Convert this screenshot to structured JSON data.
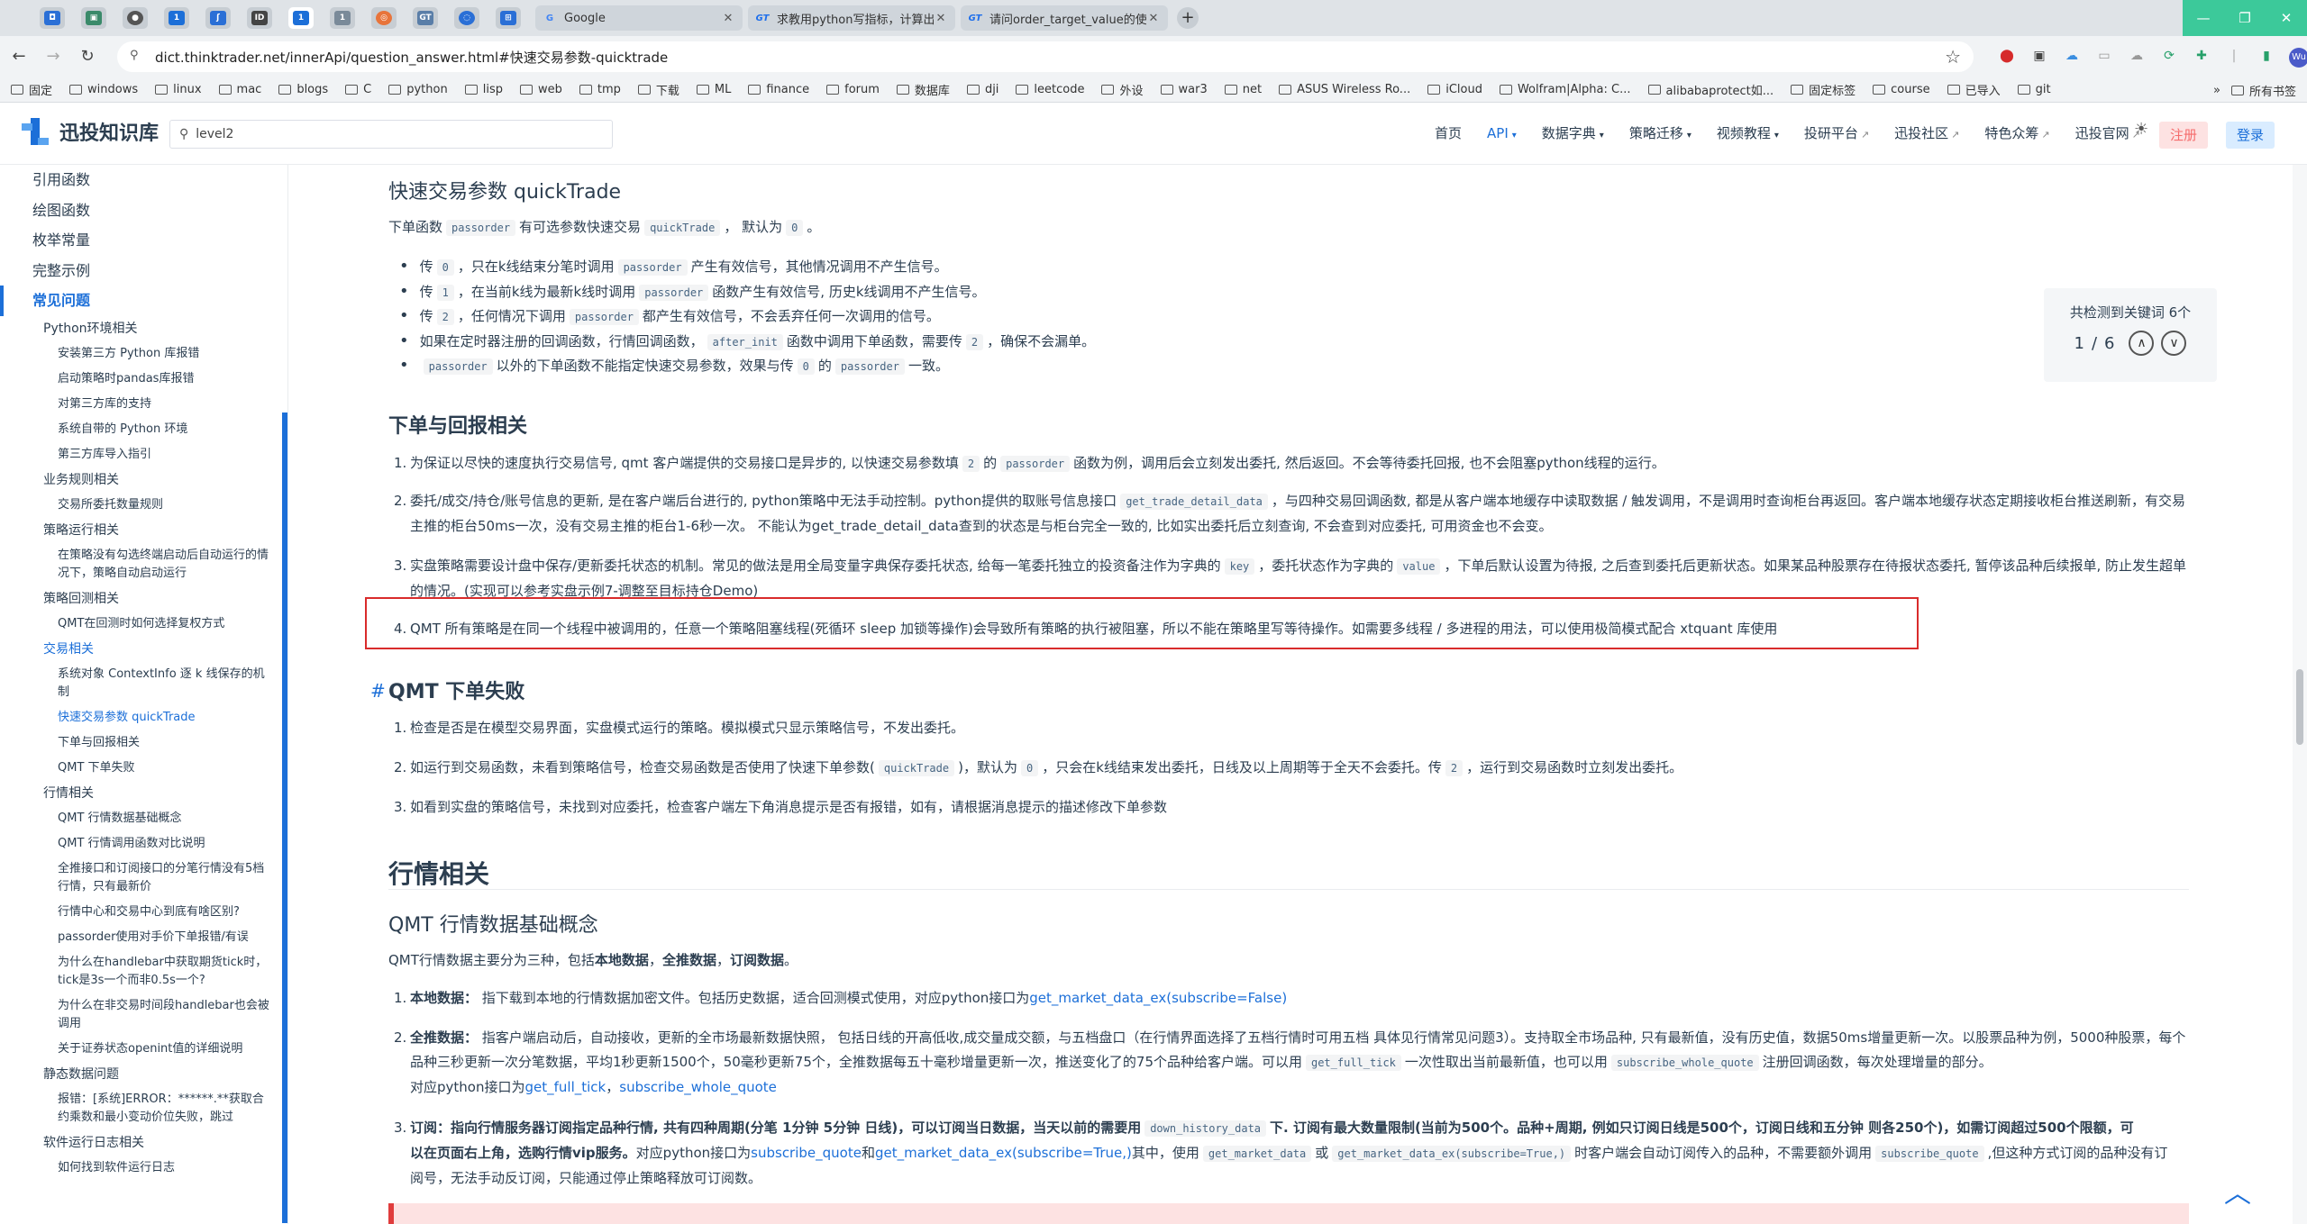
{
  "browser": {
    "tabs": [
      {
        "label": "Google",
        "icon": "google-icon"
      },
      {
        "label": "求教用python写指标，计算出",
        "icon": "gt-icon"
      },
      {
        "label": "请问order_target_value的使用",
        "icon": "gt-icon"
      }
    ],
    "url": "dict.thinktrader.net/innerApi/question_answer.html#快速交易参数-quicktrade",
    "bookmarks": [
      "固定",
      "windows",
      "linux",
      "mac",
      "blogs",
      "C",
      "python",
      "lisp",
      "web",
      "tmp",
      "下载",
      "ML",
      "finance",
      "forum",
      "数据库",
      "dji",
      "leetcode",
      "外设",
      "war3",
      "net",
      "ASUS Wireless Ro...",
      "iCloud",
      "Wolfram|Alpha: C...",
      "alibabaprotect如...",
      "固定标签",
      "course",
      "已导入",
      "git"
    ],
    "bookmarks_more": "»",
    "all_bookmarks": "所有书签"
  },
  "site": {
    "title": "迅投知识库",
    "search_value": "level2",
    "nav": [
      {
        "label": "首页",
        "caret": false,
        "ext": false,
        "active": false
      },
      {
        "label": "API",
        "caret": true,
        "ext": false,
        "active": true
      },
      {
        "label": "数据字典",
        "caret": true,
        "ext": false,
        "active": false
      },
      {
        "label": "策略迁移",
        "caret": true,
        "ext": false,
        "active": false
      },
      {
        "label": "视频教程",
        "caret": true,
        "ext": false,
        "active": false
      },
      {
        "label": "投研平台",
        "caret": false,
        "ext": true,
        "active": false
      },
      {
        "label": "迅投社区",
        "caret": false,
        "ext": true,
        "active": false
      },
      {
        "label": "特色众筹",
        "caret": false,
        "ext": true,
        "active": false
      },
      {
        "label": "迅投官网",
        "caret": false,
        "ext": true,
        "active": false
      }
    ],
    "register": "注册",
    "login": "登录"
  },
  "sidebar": {
    "top": [
      "引用函数",
      "绘图函数",
      "枚举常量",
      "完整示例"
    ],
    "active_section": "常见问题",
    "items": [
      {
        "level": 2,
        "label": "Python环境相关"
      },
      {
        "level": 3,
        "label": "安装第三方 Python 库报错"
      },
      {
        "level": 3,
        "label": "启动策略时pandas库报错"
      },
      {
        "level": 3,
        "label": "对第三方库的支持"
      },
      {
        "level": 3,
        "label": "系统自带的 Python 环境"
      },
      {
        "level": 3,
        "label": "第三方库导入指引"
      },
      {
        "level": 2,
        "label": "业务规则相关"
      },
      {
        "level": 3,
        "label": "交易所委托数量规则"
      },
      {
        "level": 2,
        "label": "策略运行相关"
      },
      {
        "level": 3,
        "label": "在策略没有勾选终端启动后自动运行的情况下，策略自动启动运行"
      },
      {
        "level": 2,
        "label": "策略回测相关"
      },
      {
        "level": 3,
        "label": "QMT在回测时如何选择复权方式"
      },
      {
        "level": 2,
        "label": "交易相关",
        "active": true
      },
      {
        "level": 3,
        "label": "系统对象 ContextInfo 逐 k 线保存的机制"
      },
      {
        "level": 3,
        "label": "快速交易参数 quickTrade",
        "active": true
      },
      {
        "level": 3,
        "label": "下单与回报相关"
      },
      {
        "level": 3,
        "label": "QMT 下单失败"
      },
      {
        "level": 2,
        "label": "行情相关"
      },
      {
        "level": 3,
        "label": "QMT 行情数据基础概念"
      },
      {
        "level": 3,
        "label": "QMT 行情调用函数对比说明"
      },
      {
        "level": 3,
        "label": "全推接口和订阅接口的分笔行情没有5档行情，只有最新价"
      },
      {
        "level": 3,
        "label": "行情中心和交易中心到底有啥区别?"
      },
      {
        "level": 3,
        "label": "passorder使用对手价下单报错/有误"
      },
      {
        "level": 3,
        "label": "为什么在handlebar中获取期货tick时，tick是3s一个而非0.5s一个?"
      },
      {
        "level": 3,
        "label": "为什么在非交易时间段handlebar也会被调用"
      },
      {
        "level": 3,
        "label": "关于证券状态openint值的详细说明"
      },
      {
        "level": 2,
        "label": "静态数据问题"
      },
      {
        "level": 3,
        "label": "报错：[系统]ERROR：******.**获取合约乘数和最小变动价位失败，跳过"
      },
      {
        "level": 2,
        "label": "软件运行日志相关"
      },
      {
        "level": 3,
        "label": "如何找到软件运行日志"
      }
    ]
  },
  "content": {
    "quicktrade": {
      "title": "快速交易参数 quickTrade",
      "intro": [
        "下单函数",
        "passorder",
        "有可选参数快速交易",
        "quickTrade",
        "，  默认为",
        "0",
        "。"
      ],
      "bullets": [
        [
          "传",
          "0",
          "，只在k线结束分笔时调用",
          "passorder",
          "产生有效信号，其他情况调用不产生信号。"
        ],
        [
          "传",
          "1",
          "，在当前k线为最新k线时调用",
          "passorder",
          "函数产生有效信号, 历史k线调用不产生信号。"
        ],
        [
          "传",
          "2",
          "，任何情况下调用",
          "passorder",
          "都产生有效信号，不会丢弃任何一次调用的信号。"
        ],
        [
          "如果在定时器注册的回调函数，行情回调函数，",
          "after_init",
          "函数中调用下单函数，需要传",
          "2",
          "，确保不会漏单。"
        ],
        [
          "",
          "passorder",
          "以外的下单函数不能指定快速交易参数，效果与传",
          "0",
          "的",
          "passorder",
          "一致。"
        ]
      ]
    },
    "order_report": {
      "title": "下单与回报相关",
      "items": [
        [
          "1.",
          "为保证以尽快的速度执行交易信号, qmt 客户端提供的交易接口是异步的, 以快速交易参数填",
          "2",
          "的",
          "passorder",
          "函数为例，调用后会立刻发出委托, 然后返回。不会等待委托回报, 也不会阻塞python线程的运行。"
        ],
        [
          "2.",
          "委托/成交/持仓/账号信息的更新, 是在客户端后台进行的, python策略中无法手动控制。python提供的取账号信息接口",
          "get_trade_detail_data",
          "，与四种交易回调函数, 都是从客户端本地缓存中读取数据 / 触发调用，不是调用时查询柜台再返回。客户端本地缓存状态定期接收柜台推送刷新，有交易主推的柜台50ms一次，没有交易主推的柜台1-6秒一次。 不能认为get_trade_detail_data查到的状态是与柜台完全一致的, 比如实出委托后立刻查询, 不会查到对应委托, 可用资金也不会变。"
        ],
        [
          "3.",
          "实盘策略需要设计盘中保存/更新委托状态的机制。常见的做法是用全局变量字典保存委托状态, 给每一笔委托独立的投资备注作为字典的",
          "key",
          "，委托状态作为字典的",
          "value",
          "，下单后默认设置为待报, 之后查到委托后更新状态。如果某品种股票存在待报状态委托, 暂停该品种后续报单, 防止发生超单的情况。(实现可以参考实盘示例7-调整至目标持仓Demo)"
        ],
        [
          "4.",
          "QMT 所有策略是在同一个线程中被调用的，任意一个策略阻塞线程(死循环 sleep 加锁等操作)会导致所有策略的执行被阻塞，所以不能在策略里写等待操作。如需要多线程 / 多进程的用法，可以使用极简模式配合 xtquant 库使用"
        ]
      ]
    },
    "order_fail": {
      "hash": "#",
      "title": "QMT 下单失败",
      "items": [
        [
          "1.",
          "检查是否是在模型交易界面，实盘模式运行的策略。模拟模式只显示策略信号，不发出委托。"
        ],
        [
          "2.",
          "如运行到交易函数，未看到策略信号，检查交易函数是否使用了快速下单参数(",
          "quickTrade",
          ")，默认为",
          "0",
          "，只会在k线结束发出委托，日线及以上周期等于全天不会委托。传",
          "2",
          "，运行到交易函数时立刻发出委托。"
        ],
        [
          "3.",
          "如看到实盘的策略信号，未找到对应委托，检查客户端左下角消息提示是否有报错，如有，请根据消息提示的描述修改下单参数"
        ]
      ]
    },
    "market": {
      "section_title": "行情相关",
      "sub_title": "QMT 行情数据基础概念",
      "intro": [
        "QMT行情数据主要分为三种，包括",
        "本地数据",
        "，",
        "全推数据",
        "，",
        "订阅数据",
        "。"
      ],
      "item1": [
        "1.",
        "本地数据：",
        " 指下载到本地的行情数据加密文件。包括历史数据，适合回测模式使用，对应python接口为",
        "get_market_data_ex(subscribe=False)"
      ],
      "item2_a": [
        "2.",
        "全推数据：",
        " 指客户端启动后，自动接收，更新的全市场最新数据快照， 包括日线的开高低收,成交量成交额，与五档盘口（在行情界面选择了五档行情时可用五档 具体见行情常见问题3）。支持取全市场品种, 只有最新值，没有历史值，数据50ms增量更新一次。以股票品种为例，5000种股票，每个品种三秒更新一次分笔数据，平均1秒更新1500个，50毫秒更新75个，全推数据每五十毫秒增量更新一次，推送变化了的75个品种给客户端。可以用",
        "get_full_tick",
        "一次性取出当前最新值，也可以用",
        "subscribe_whole_quote",
        "注册回调函数，每次处理增量的部分。"
      ],
      "item2_b": [
        "对应python接口为",
        "get_full_tick",
        "，",
        "subscribe_whole_quote"
      ],
      "item3_a": [
        "3.",
        "订阅：",
        "指向行情服务器订阅指定品种行情, 共有四种周期(分笔 1分钟 5分钟 日线)，可以订阅当日数据，当天以前的需要用",
        "down_history_data",
        "下. 订阅有最大数量限制(当前为500个。品种+周期, 例如只订阅日线是500个，订阅日线和五分钟 则各250个)，如需订阅超过500个限额，可"
      ],
      "item3_b": [
        "以在页面右上角，选购行情vip服务。",
        "对应python接口为",
        "subscribe_quote",
        "和",
        "get_market_data_ex(subscribe=True,)",
        "其中，使用",
        "get_market_data",
        "或",
        "get_market_data_ex(subscribe=True,)",
        "时客户端会自动订阅传入的品种，不需要额外调用",
        "subscribe_quote",
        ",但这种方式订阅的品种没有订"
      ],
      "item3_c": "阅号，无法手动反订阅，只能通过停止策略释放可订阅数。"
    }
  },
  "find": {
    "title": "共检测到关键词 6个",
    "current": "1",
    "sep": "/",
    "total": "6"
  }
}
